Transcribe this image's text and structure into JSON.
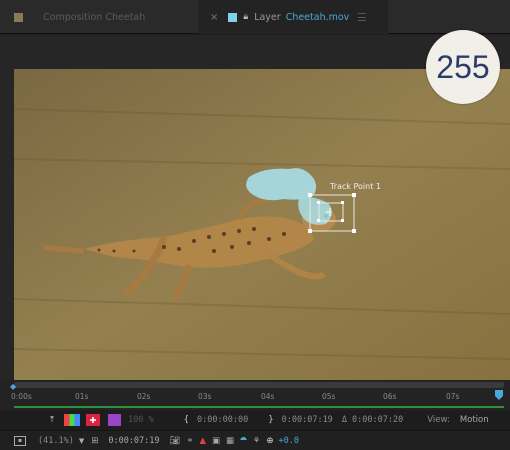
{
  "tabs": {
    "composition": {
      "label": "Composition Cheetah",
      "color": "#8a7a5a"
    },
    "layer": {
      "prefix": "Layer",
      "name": "Cheetah.mov",
      "color": "#7fd0e8"
    }
  },
  "badge": {
    "number": "255"
  },
  "viewer": {
    "track_point_label": "Track Point 1"
  },
  "timeline": {
    "ticks": [
      "0:00s",
      "01s",
      "02s",
      "03s",
      "04s",
      "05s",
      "06s",
      "07s"
    ],
    "accent": "#4aa9d8"
  },
  "controls": {
    "opacity": "100 %",
    "in_point": "0:00:00:00",
    "out_point": "0:00:07:19",
    "duration": "Δ 0:00:07:20",
    "view_label": "View:",
    "view_value": "Motion"
  },
  "status": {
    "zoom": "(41.1%)",
    "timecode": "0:00:07:19",
    "exposure": "+0.0"
  }
}
